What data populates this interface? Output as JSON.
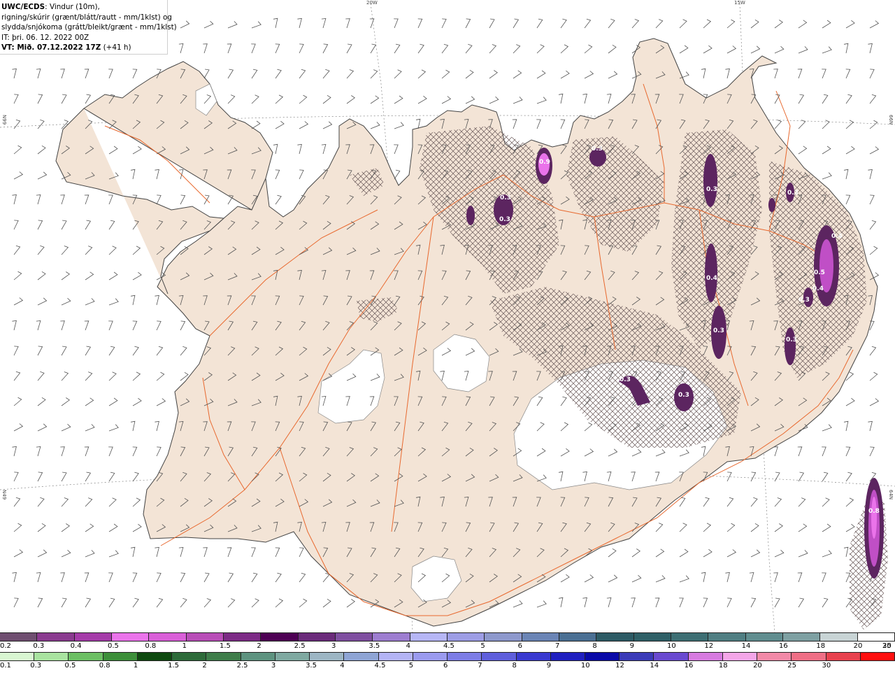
{
  "header": {
    "model": "UWC/ECDS",
    "title_rest": ": Vindur (10m),",
    "line2": "rigning/skúrir (grænt/blátt/rautt - mm/1klst) og",
    "line3": "slydda/snjókoma (grátt/bleikt/grænt - mm/1klst)",
    "init": "IT: þri. 06. 12. 2022 00Z",
    "valid_bold": "VT: Mið. 07.12.2022 17Z",
    "valid_offset": " (+41 h)"
  },
  "grid_labels": {
    "lon_20w": "20W",
    "lon_15w": "15W",
    "lat_66n_left": "N99",
    "lat_66n_right": "66N",
    "lat_64n_left": "N49",
    "lat_64n_right": "64N"
  },
  "contour_labels": [
    {
      "text": "0.9"
    },
    {
      "text": "0.3"
    },
    {
      "text": "0.3"
    },
    {
      "text": "0.3"
    },
    {
      "text": "0.3"
    },
    {
      "text": "0.3"
    },
    {
      "text": "0.4"
    },
    {
      "text": "0.5"
    },
    {
      "text": "0.4"
    },
    {
      "text": "0.4"
    },
    {
      "text": "0.3"
    },
    {
      "text": "0.3"
    },
    {
      "text": "0.3"
    },
    {
      "text": "0.3"
    },
    {
      "text": "0.3"
    },
    {
      "text": "0.8"
    }
  ],
  "legend_snow": {
    "colors": [
      "#6f4e70",
      "#8a3a8f",
      "#a43aa8",
      "#ea73ea",
      "#d95ed8",
      "#b84cb7",
      "#7c2a85",
      "#4d0053",
      "#6a2a7a",
      "#7f4ea0",
      "#9d7dd0",
      "#b6b6f5",
      "#9d9de5",
      "#8d98cc",
      "#6a84b5",
      "#4a6f93",
      "#2c5a64",
      "#2e5f66",
      "#3d6e73",
      "#4f7e82",
      "#608d8f",
      "#7ea0a2",
      "#c8d4d5",
      "#ffffff"
    ],
    "labels": [
      "0.2",
      "0.3",
      "0.4",
      "0.5",
      "0.8",
      "1",
      "1.5",
      "2",
      "2.5",
      "3",
      "3.5",
      "4",
      "4.5",
      "5",
      "6",
      "7",
      "8",
      "9",
      "10",
      "12",
      "14",
      "16",
      "18",
      "20",
      "25",
      "30"
    ]
  },
  "legend_rain": {
    "colors": [
      "#d9f6d2",
      "#a9e3a0",
      "#6cbf64",
      "#3d8f3a",
      "#0f4a10",
      "#2e6b3a",
      "#3f7d4b",
      "#5e9380",
      "#7fa9a1",
      "#9db6c4",
      "#8fa5d5",
      "#b4b4f5",
      "#9b9bef",
      "#7d7de6",
      "#5f5fdc",
      "#3a3ad0",
      "#2020c0",
      "#0a0aa8",
      "#3b3bb8",
      "#6a4ad0",
      "#d77be0",
      "#f4a6e8",
      "#f28aa8",
      "#ef6f86",
      "#e8424f",
      "#ff1010"
    ],
    "labels": [
      "0.1",
      "0.3",
      "0.5",
      "0.8",
      "1",
      "1.5",
      "2",
      "2.5",
      "3",
      "3.5",
      "4",
      "4.5",
      "5",
      "6",
      "7",
      "8",
      "9",
      "10",
      "12",
      "14",
      "16",
      "18",
      "20",
      "25",
      "30"
    ]
  },
  "colors": {
    "land": "#f3e4d6",
    "roads": "#e8692f",
    "coast": "#444444",
    "glacier": "#ffffff",
    "snow_contour": "#5c2560",
    "snow_light": "#c04fc6",
    "hatch": "#6a5a5a"
  }
}
